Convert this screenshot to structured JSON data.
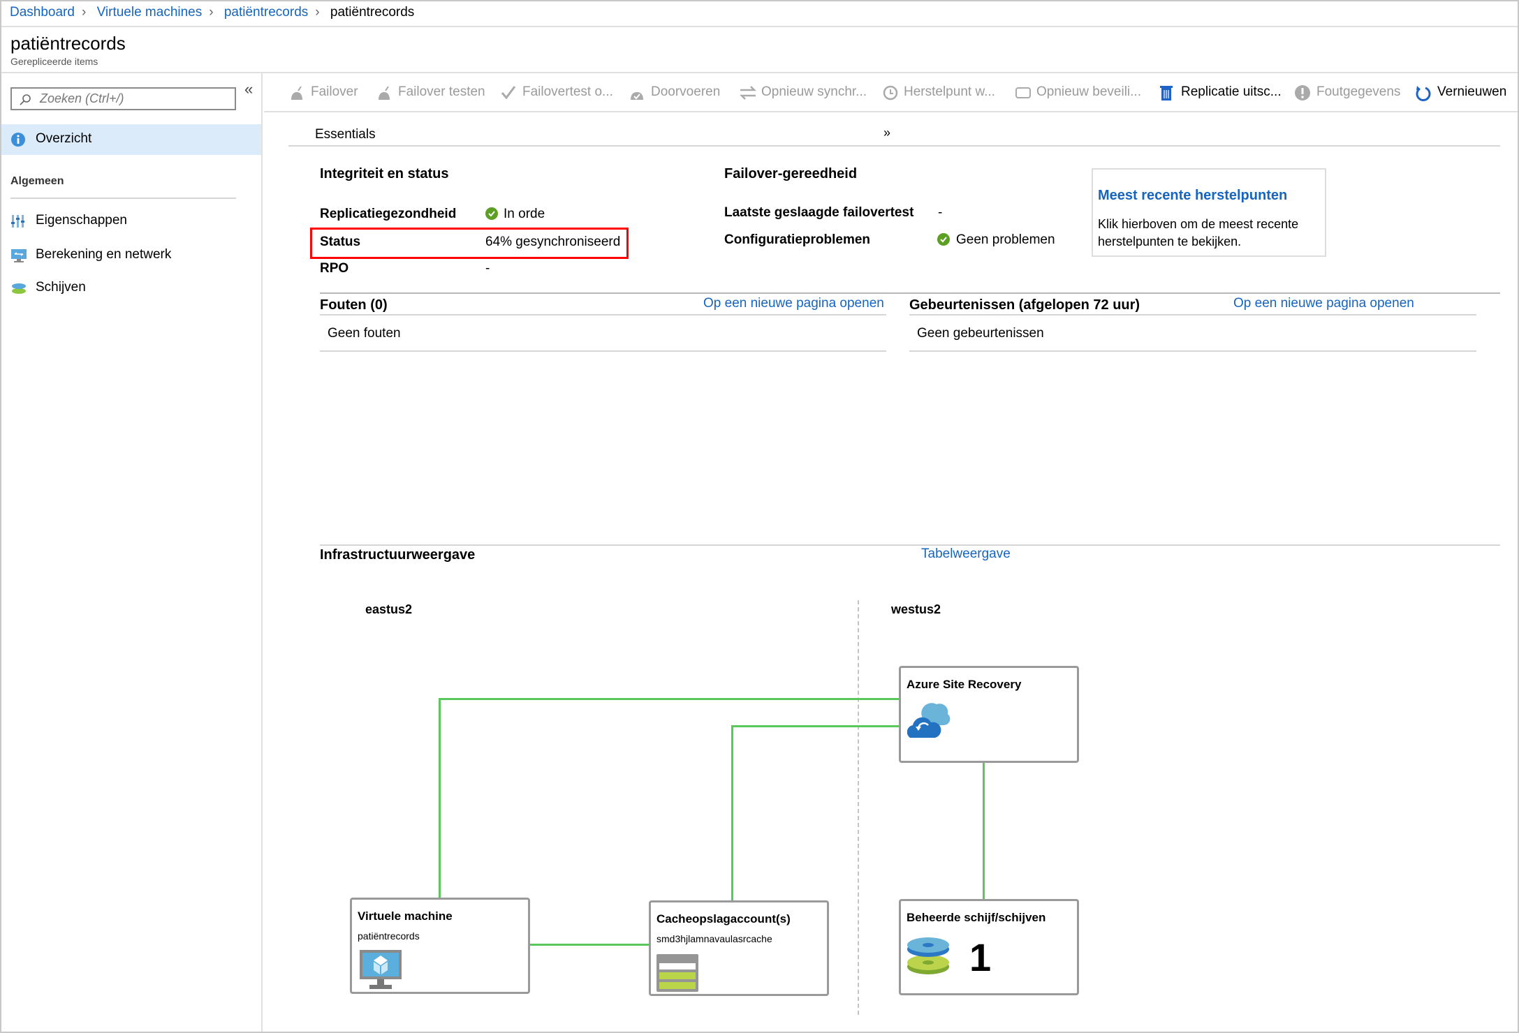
{
  "breadcrumb": [
    {
      "label": "Dashboard",
      "link": true
    },
    {
      "label": "Virtuele machines",
      "link": true
    },
    {
      "label": "patiëntrecords",
      "link": true
    },
    {
      "label": "patiëntrecords",
      "link": false
    }
  ],
  "header": {
    "title": "patiëntrecords",
    "subtitle": "Gerepliceerde items"
  },
  "sidebar": {
    "search_placeholder": "Zoeken (Ctrl+/)",
    "collapse_icon": "«",
    "overview": "Overzicht",
    "section": "Algemeen",
    "items": [
      {
        "label": "Eigenschappen",
        "icon": "properties-icon"
      },
      {
        "label": "Berekening en netwerk",
        "icon": "compute-network-icon"
      },
      {
        "label": "Schijven",
        "icon": "disks-icon"
      }
    ]
  },
  "toolbar": [
    {
      "label": "Failover",
      "enabled": false
    },
    {
      "label": "Failover testen",
      "enabled": false
    },
    {
      "label": "Failovertest o...",
      "enabled": false
    },
    {
      "label": "Doorvoeren",
      "enabled": false
    },
    {
      "label": "Opnieuw synchr...",
      "enabled": false
    },
    {
      "label": "Herstelpunt w...",
      "enabled": false
    },
    {
      "label": "Opnieuw beveili...",
      "enabled": false
    },
    {
      "label": "Replicatie uitsc...",
      "enabled": true
    },
    {
      "label": "Foutgegevens",
      "enabled": false
    },
    {
      "label": "Vernieuwen",
      "enabled": true
    }
  ],
  "essentials": {
    "label": "Essentials",
    "health": {
      "title": "Integriteit en status",
      "rows": [
        {
          "label": "Replicatiegezondheid",
          "value": "In orde"
        },
        {
          "label": "Status",
          "value": "64% gesynchroniseerd"
        },
        {
          "label": "RPO",
          "value": "-"
        }
      ]
    },
    "failover": {
      "title": "Failover-gereedheid",
      "rows": [
        {
          "label": "Laatste geslaagde failovertest",
          "value": "-"
        },
        {
          "label": "Configuratieproblemen",
          "value": "Geen problemen"
        }
      ]
    },
    "recovery_card": {
      "title": "Meest recente herstelpunten",
      "line1": "Klik hierboven om de meest recente",
      "line2": "herstelpunten te bekijken."
    }
  },
  "errors": {
    "title": "Fouten (0)",
    "link": "Op een nieuwe pagina openen",
    "empty": "Geen fouten"
  },
  "events": {
    "title": "Gebeurtenissen (afgelopen 72 uur)",
    "link": "Op een nieuwe pagina openen",
    "empty": "Geen gebeurtenissen"
  },
  "infra": {
    "title": "Infrastructuurweergave",
    "table_link": "Tabelweergave",
    "source_region": "eastus2",
    "target_region": "westus2",
    "asr": {
      "title": "Azure Site Recovery"
    },
    "vm": {
      "title": "Virtuele machine",
      "name": "patiëntrecords"
    },
    "cache": {
      "title": "Cacheopslagaccount(s)",
      "name": "smd3hjlamnavaulasrcache"
    },
    "disks": {
      "title": "Beheerde schijf/schijven",
      "count": "1"
    }
  },
  "colors": {
    "accent": "#1565c0",
    "ok": "#5ba022",
    "highlight": "#ff0000",
    "connector": "#5ac85a"
  }
}
